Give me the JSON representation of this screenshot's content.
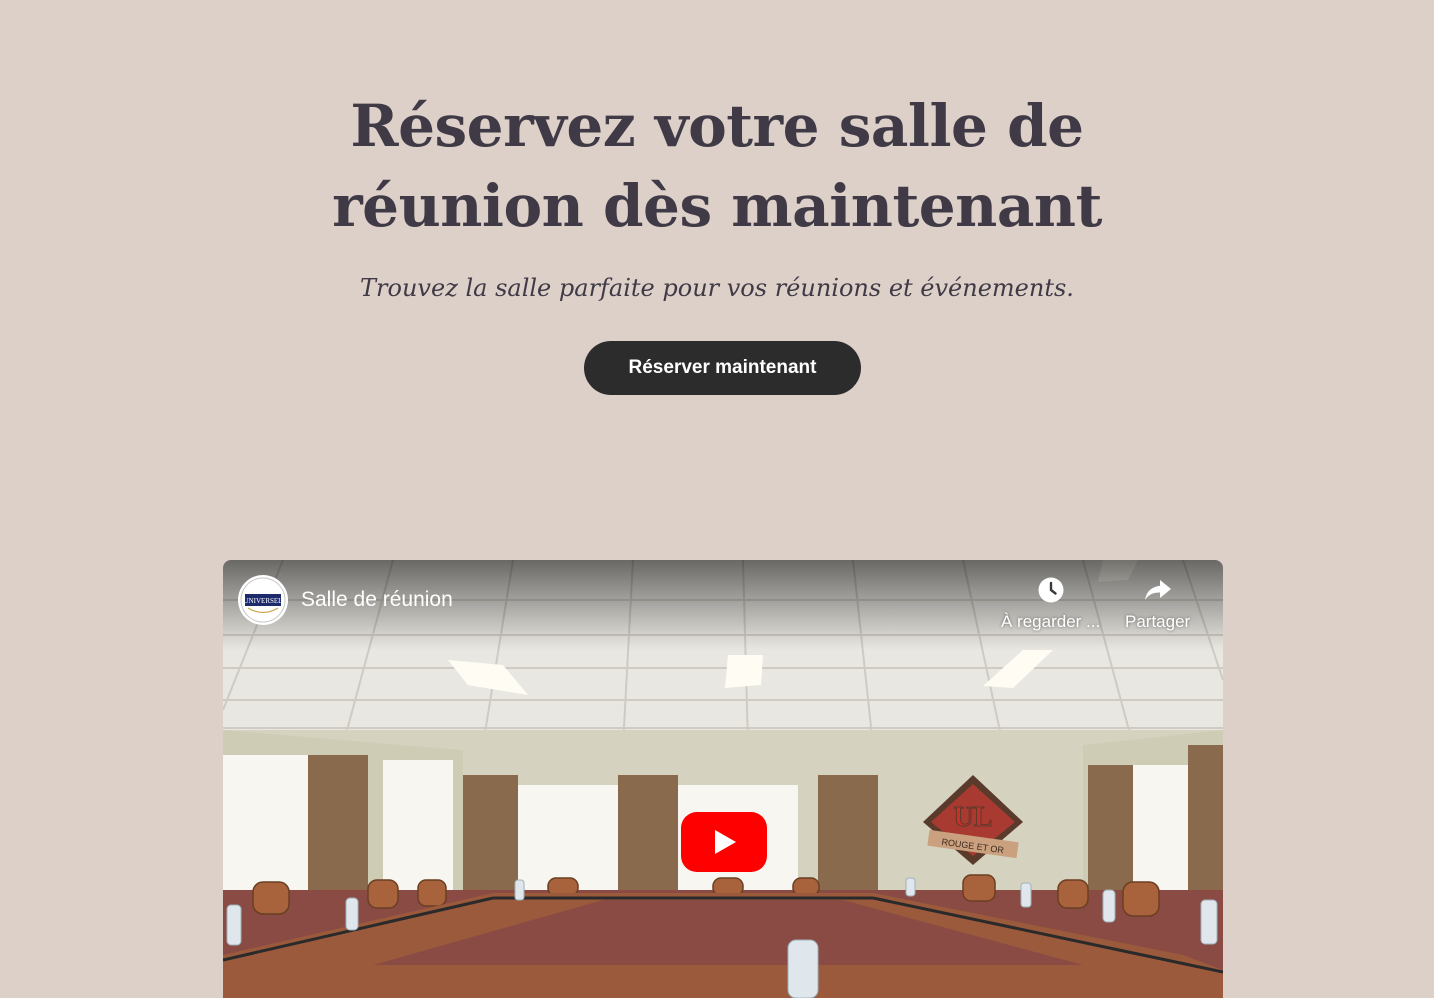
{
  "hero": {
    "title_line1": "Réservez votre salle de",
    "title_line2": "réunion dès maintenant",
    "subtitle": "Trouvez la salle parfaite pour vos réunions et événements.",
    "cta_label": "Réserver maintenant"
  },
  "video": {
    "title": "Salle de réunion",
    "channel_logo_text": "UNIVERSEL",
    "watch_later_label": "À regarder ...",
    "share_label": "Partager",
    "wall_logo_text_main": "UL",
    "wall_logo_text_sub": "ROUGE ET OR"
  },
  "colors": {
    "background": "#ddd0c8",
    "heading": "#3f3a46",
    "cta_background": "#2c2c2c",
    "youtube_red": "#ff0000"
  },
  "icons": [
    "clock-icon",
    "share-arrow-icon",
    "youtube-play-icon"
  ]
}
